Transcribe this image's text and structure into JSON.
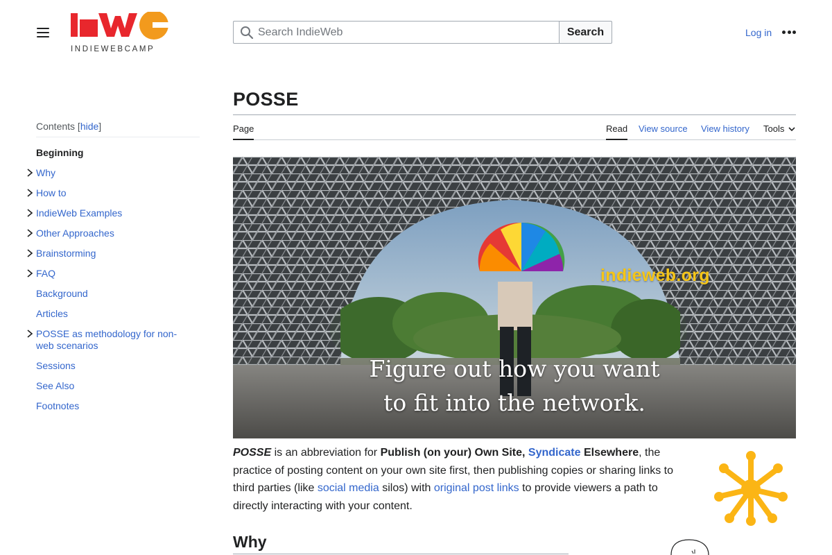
{
  "header": {
    "logo_text": "INDIEWEBCAMP",
    "search_placeholder": "Search IndieWeb",
    "search_button": "Search",
    "login": "Log in"
  },
  "toc": {
    "title": "Contents",
    "hide_label": "hide",
    "items": [
      {
        "label": "Beginning",
        "expandable": false,
        "active": true
      },
      {
        "label": "Why",
        "expandable": true
      },
      {
        "label": "How to",
        "expandable": true
      },
      {
        "label": "IndieWeb Examples",
        "expandable": true
      },
      {
        "label": "Other Approaches",
        "expandable": true
      },
      {
        "label": "Brainstorming",
        "expandable": true
      },
      {
        "label": "FAQ",
        "expandable": true
      },
      {
        "label": "Background",
        "expandable": false
      },
      {
        "label": "Articles",
        "expandable": false
      },
      {
        "label": "POSSE as methodology for non-web scenarios",
        "expandable": true
      },
      {
        "label": "Sessions",
        "expandable": false
      },
      {
        "label": "See Also",
        "expandable": false
      },
      {
        "label": "Footnotes",
        "expandable": false
      }
    ]
  },
  "page": {
    "title": "POSSE",
    "tabs": {
      "page": "Page",
      "read": "Read",
      "view_source": "View source",
      "view_history": "View history",
      "tools": "Tools"
    }
  },
  "hero": {
    "url_text": "indieweb.org",
    "caption_line1": "Figure out how you want",
    "caption_line2": "to fit into the network."
  },
  "intro": {
    "abbr": "POSSE",
    "t1": " is an abbreviation for ",
    "b1": "Publish (on your) Own Site, ",
    "syndicate": "Syndicate",
    "b2": " Elsewhere",
    "t2": ", the practice of posting content on your own site first, then publishing copies or sharing links to third parties (like ",
    "social_media": "social media",
    "t3": " silos) with ",
    "original_post_links": "original post links",
    "t4": " to provide viewers a path to directly interacting with your content."
  },
  "section_why": "Why",
  "colors": {
    "link": "#3366cc",
    "logo_red": "#e8272d",
    "logo_orange": "#f29a1d",
    "sun_yellow": "#fbb515",
    "hero_url": "#f5c518"
  }
}
